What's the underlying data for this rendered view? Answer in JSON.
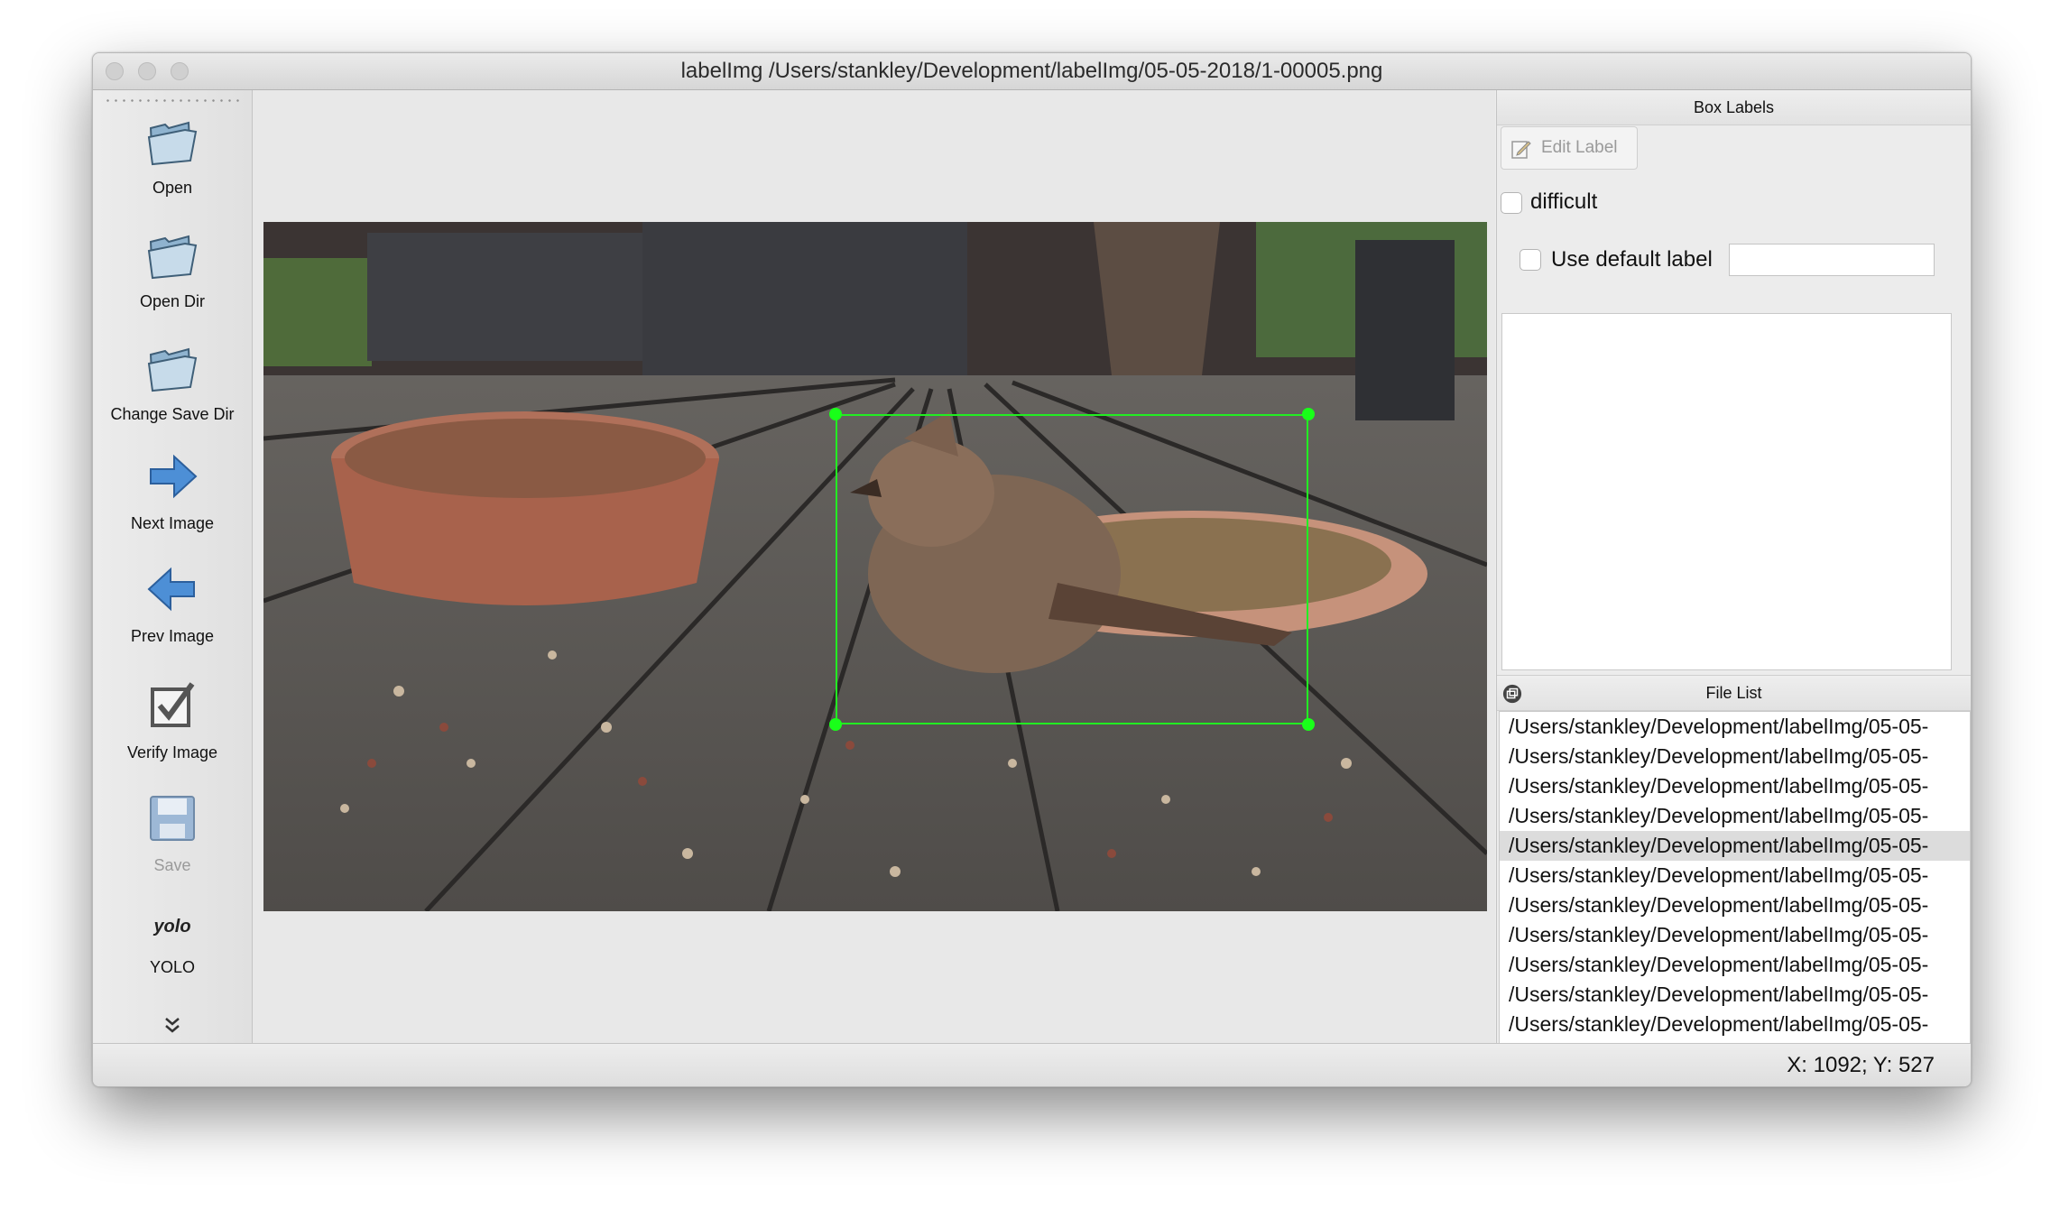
{
  "window": {
    "title": "labelImg /Users/stankley/Development/labelImg/05-05-2018/1-00005.png"
  },
  "toolbar": {
    "items": [
      {
        "label": "Open",
        "icon": "folder-icon",
        "enabled": true
      },
      {
        "label": "Open Dir",
        "icon": "folder-icon",
        "enabled": true
      },
      {
        "label": "Change Save Dir",
        "icon": "folder-icon",
        "enabled": true
      },
      {
        "label": "Next Image",
        "icon": "arrow-right-icon",
        "enabled": true
      },
      {
        "label": "Prev Image",
        "icon": "arrow-left-icon",
        "enabled": true
      },
      {
        "label": "Verify Image",
        "icon": "checkbox-icon",
        "enabled": true
      },
      {
        "label": "Save",
        "icon": "floppy-disk-icon",
        "enabled": false
      },
      {
        "label": "YOLO",
        "icon_text": "yolo",
        "enabled": true
      }
    ],
    "more_icon": "double-chevron-down-icon"
  },
  "canvas": {
    "image_description": "bird on wooden deck",
    "box_color": "#22ee22"
  },
  "box_labels_dock": {
    "title": "Box Labels",
    "edit_label_button": "Edit Label",
    "difficult_label": "difficult",
    "difficult_checked": false,
    "use_default_label": "Use default label",
    "use_default_checked": false,
    "default_label_value": ""
  },
  "file_list_dock": {
    "title": "File List",
    "selected_index": 4,
    "files": [
      "/Users/stankley/Development/labelImg/05-05-",
      "/Users/stankley/Development/labelImg/05-05-",
      "/Users/stankley/Development/labelImg/05-05-",
      "/Users/stankley/Development/labelImg/05-05-",
      "/Users/stankley/Development/labelImg/05-05-",
      "/Users/stankley/Development/labelImg/05-05-",
      "/Users/stankley/Development/labelImg/05-05-",
      "/Users/stankley/Development/labelImg/05-05-",
      "/Users/stankley/Development/labelImg/05-05-",
      "/Users/stankley/Development/labelImg/05-05-",
      "/Users/stankley/Development/labelImg/05-05-"
    ]
  },
  "statusbar": {
    "coords": "X: 1092; Y: 527"
  }
}
